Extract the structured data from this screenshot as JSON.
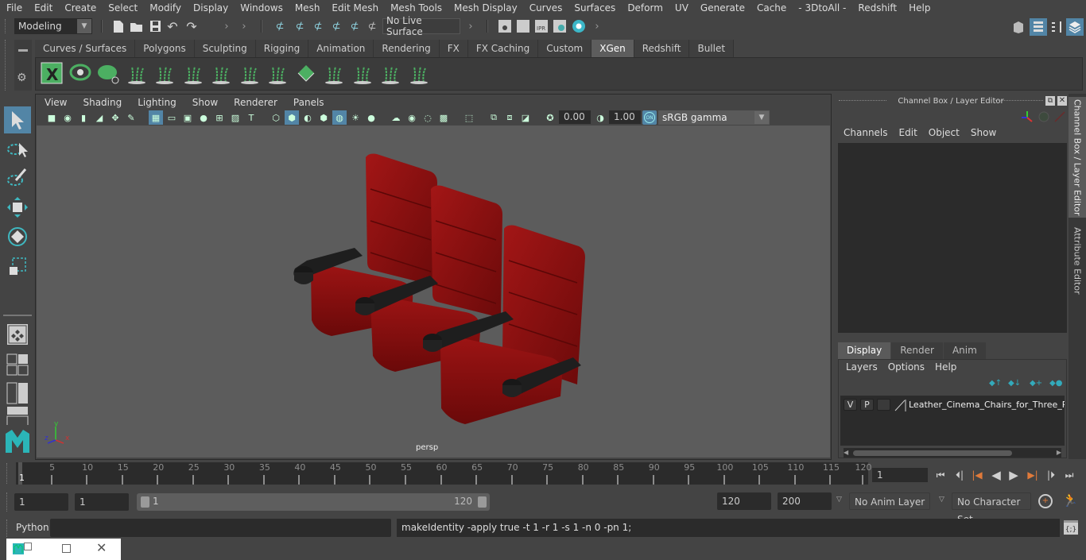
{
  "menubar": [
    "File",
    "Edit",
    "Create",
    "Select",
    "Modify",
    "Display",
    "Windows",
    "Mesh",
    "Edit Mesh",
    "Mesh Tools",
    "Mesh Display",
    "Curves",
    "Surfaces",
    "Deform",
    "UV",
    "Generate",
    "Cache",
    "- 3DtoAll -",
    "Redshift",
    "Help"
  ],
  "statusline": {
    "mode": "Modeling",
    "live_surface": "No Live Surface",
    "ipr_label": "IPR"
  },
  "shelf": {
    "tabs": [
      "Curves / Surfaces",
      "Polygons",
      "Sculpting",
      "Rigging",
      "Animation",
      "Rendering",
      "FX",
      "FX Caching",
      "Custom",
      "XGen",
      "Redshift",
      "Bullet"
    ],
    "active_tab": "XGen",
    "icons": [
      "xgen-description-editor-icon",
      "xgen-preview-icon",
      "xgen-clear-preview-icon",
      "xgen-add-guides-icon",
      "xgen-place-guides-icon",
      "xgen-add-guide-icon",
      "xgen-show-guides-icon",
      "xgen-lock-guides-icon",
      "xgen-split-guide-icon",
      "xgen-surface-icon",
      "xgen-sculpt-guides-icon",
      "xgen-select-guides-icon",
      "xgen-guide-bounds-icon",
      "xgen-delete-guides-icon"
    ]
  },
  "viewport": {
    "menu": [
      "View",
      "Shading",
      "Lighting",
      "Show",
      "Renderer",
      "Panels"
    ],
    "exposure": "0.00",
    "gamma": "1.00",
    "color_mgmt_toggle": "ON",
    "color_space": "sRGB gamma",
    "camera_label": "persp",
    "axis": {
      "x": "x",
      "y": "y",
      "z": "z"
    }
  },
  "right_panel": {
    "title": "Channel Box / Layer Editor",
    "channel_menu": [
      "Channels",
      "Edit",
      "Object",
      "Show"
    ],
    "layer_tabs": [
      "Display",
      "Render",
      "Anim"
    ],
    "active_layer_tab": "Display",
    "layer_menu": [
      "Layers",
      "Options",
      "Help"
    ],
    "layers": [
      {
        "visible": "V",
        "playback": "P",
        "name": "Leather_Cinema_Chairs_for_Three_Places"
      }
    ],
    "side_tabs": [
      "Channel Box / Layer Editor",
      "Attribute Editor"
    ]
  },
  "timeline": {
    "ticks": [
      5,
      10,
      15,
      20,
      25,
      30,
      35,
      40,
      45,
      50,
      55,
      60,
      65,
      70,
      75,
      80,
      85,
      90,
      95,
      100,
      105,
      110,
      115,
      120
    ],
    "start_label": "1",
    "current_frame": "1",
    "range_max": 120
  },
  "range": {
    "start": "1",
    "playback_start": "1",
    "slider_min": "1",
    "slider_max": "120",
    "playback_end": "120",
    "end": "200",
    "anim_layer": "No Anim Layer",
    "character_set": "No Character Set"
  },
  "command": {
    "language": "Python",
    "input": "",
    "output": "makeIdentity -apply true -t 1 -r 1 -s 1 -n 0 -pn 1;"
  },
  "colors": {
    "accent": "#5285a6",
    "xgen_green": "#4caf62",
    "maya_teal": "#2bb5b8",
    "keyframe_orange": "#e07a3a",
    "chair_red": "#8b0d0d"
  }
}
